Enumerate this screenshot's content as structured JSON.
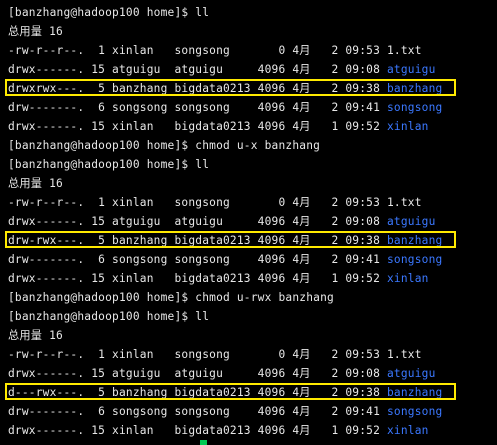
{
  "theme": {
    "background": "#000000",
    "text": "#e8e8e8",
    "dir_color": "#3b78ff",
    "highlight_color": "#ffea00",
    "cursor_color": "#00c853"
  },
  "lines": [
    {
      "text": "[banzhang@hadoop100 home]$ ll"
    },
    {
      "text": "总用量 16"
    },
    {
      "text": "-rw-r--r--.  1 xinlan   songsong       0 4月   2 09:53 1.txt"
    },
    {
      "text": "drwx------. 15 atguigu  atguigu     4096 4月   2 09:08 ",
      "dir": "atguigu"
    },
    {
      "text": "drwxrwx---.  5 banzhang bigdata0213 4096 4月   2 09:38 ",
      "dir": "banzhang",
      "highlight": true
    },
    {
      "text": "drw-------.  6 songsong songsong    4096 4月   2 09:41 ",
      "dir": "songsong"
    },
    {
      "text": "drwx------. 15 xinlan   bigdata0213 4096 4月   1 09:52 ",
      "dir": "xinlan"
    },
    {
      "text": "[banzhang@hadoop100 home]$ chmod u-x banzhang"
    },
    {
      "text": "[banzhang@hadoop100 home]$ ll"
    },
    {
      "text": "总用量 16"
    },
    {
      "text": "-rw-r--r--.  1 xinlan   songsong       0 4月   2 09:53 1.txt"
    },
    {
      "text": "drwx------. 15 atguigu  atguigu     4096 4月   2 09:08 ",
      "dir": "atguigu"
    },
    {
      "text": "drw-rwx---.  5 banzhang bigdata0213 4096 4月   2 09:38 ",
      "dir": "banzhang",
      "highlight": true
    },
    {
      "text": "drw-------.  6 songsong songsong    4096 4月   2 09:41 ",
      "dir": "songsong"
    },
    {
      "text": "drwx------. 15 xinlan   bigdata0213 4096 4月   1 09:52 ",
      "dir": "xinlan"
    },
    {
      "text": "[banzhang@hadoop100 home]$ chmod u-rwx banzhang"
    },
    {
      "text": "[banzhang@hadoop100 home]$ ll"
    },
    {
      "text": "总用量 16"
    },
    {
      "text": "-rw-r--r--.  1 xinlan   songsong       0 4月   2 09:53 1.txt"
    },
    {
      "text": "drwx------. 15 atguigu  atguigu     4096 4月   2 09:08 ",
      "dir": "atguigu"
    },
    {
      "text": "d---rwx---.  5 banzhang bigdata0213 4096 4月   2 09:38 ",
      "dir": "banzhang",
      "highlight": true
    },
    {
      "text": "drw-------.  6 songsong songsong    4096 4月   2 09:41 ",
      "dir": "songsong"
    },
    {
      "text": "drwx------. 15 xinlan   bigdata0213 4096 4月   1 09:52 ",
      "dir": "xinlan"
    }
  ]
}
